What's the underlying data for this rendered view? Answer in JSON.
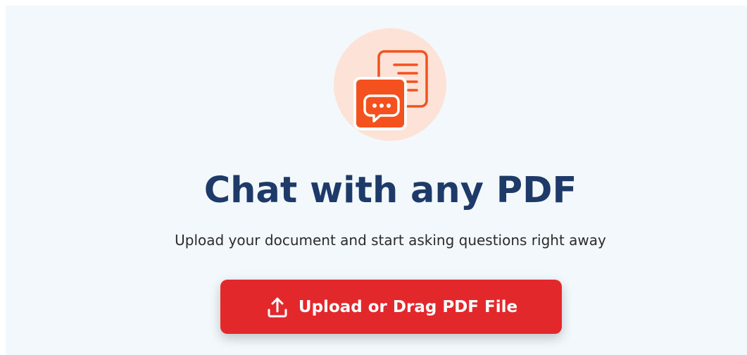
{
  "hero": {
    "icon": "chat-document-icon",
    "title": "Chat with any PDF",
    "subtitle": "Upload your document and start asking questions right away"
  },
  "upload": {
    "icon": "upload-icon",
    "label": "Upload or Drag PDF File"
  },
  "colors": {
    "page_background": "#f2f8fc",
    "icon_circle": "#fde3d7",
    "icon_accent": "#f4511e",
    "title": "#1e3a68",
    "button": "#e3282c",
    "button_text": "#ffffff"
  }
}
